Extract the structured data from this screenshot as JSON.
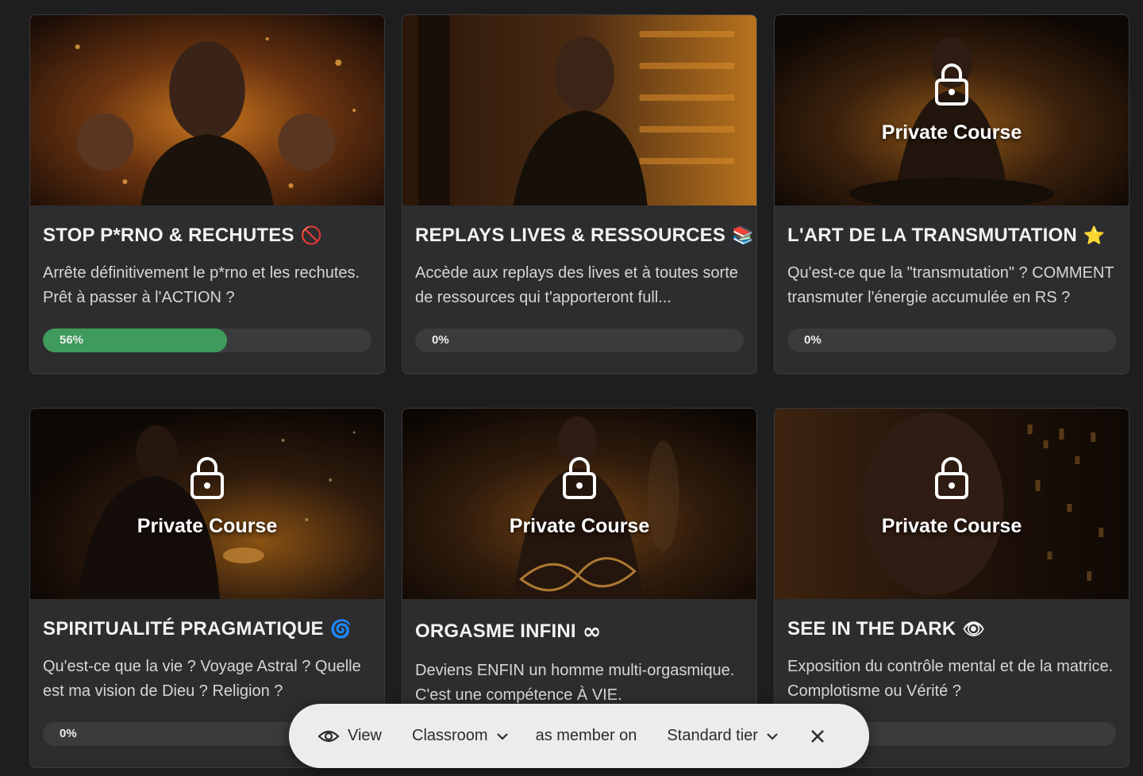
{
  "cards": [
    {
      "title": "STOP P*RNO & RECHUTES",
      "emoji": "🚫",
      "description": "Arrête définitivement le p*rno et les rechutes. Prêt à passer à l'ACTION ?",
      "progress_label": "56%",
      "progress": 56,
      "locked": false,
      "lock_label": ""
    },
    {
      "title": "REPLAYS LIVES & RESSOURCES",
      "emoji": "📚",
      "description": "Accède aux replays des lives et à toutes sorte de ressources qui t'apporteront full...",
      "progress_label": "0%",
      "progress": 0,
      "locked": false,
      "lock_label": ""
    },
    {
      "title": "L'ART DE LA TRANSMUTATION",
      "emoji": "⭐",
      "description": "Qu'est-ce que la \"transmutation\" ? COMMENT transmuter l'énergie accumulée en RS ?",
      "progress_label": "0%",
      "progress": 0,
      "locked": true,
      "lock_label": "Private Course"
    },
    {
      "title": "SPIRITUALITÉ PRAGMATIQUE",
      "emoji": "🌀",
      "description": "Qu'est-ce que la vie ? Voyage Astral ? Quelle est ma vision de Dieu ? Religion ?",
      "progress_label": "0%",
      "progress": 0,
      "locked": true,
      "lock_label": "Private Course"
    },
    {
      "title": "ORGASME INFINI",
      "emoji": "∞",
      "description": "Deviens ENFIN un homme multi-orgasmique. C'est une compétence À VIE.",
      "progress_label": "",
      "progress": 0,
      "locked": true,
      "lock_label": "Private Course"
    },
    {
      "title": "SEE IN THE DARK",
      "emoji": "👁",
      "description": "Exposition du contrôle mental et de la matrice. Complotisme ou Vérité ?",
      "progress_label": "",
      "progress": 0,
      "locked": true,
      "lock_label": "Private Course"
    }
  ],
  "toolbar": {
    "view_label": "View",
    "classroom_label": "Classroom",
    "member_label": "as member on",
    "tier_label": "Standard tier",
    "icons": {
      "view": "eye-icon",
      "dropdown": "chevron-down-icon",
      "close": "close-icon"
    }
  },
  "colors": {
    "background": "#1e1e1f",
    "card": "#2d2d2f",
    "progress_track": "#3b3b3e",
    "progress_fill": "#3f9b5b",
    "toolbar": "#ececec"
  }
}
